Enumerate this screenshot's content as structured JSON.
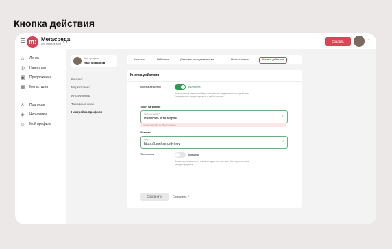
{
  "page_title": "Кнопка действия",
  "brand": {
    "name": "Мегасреда",
    "sub": "для людей в деле",
    "logo_letter": "m:"
  },
  "topbar": {
    "create_label": "Создать"
  },
  "sidebar": {
    "items": [
      {
        "label": "Лента",
        "icon": "home-icon",
        "glyph": "⌂"
      },
      {
        "label": "Навигатор",
        "icon": "compass-icon",
        "glyph": "◎"
      },
      {
        "label": "Предложения",
        "icon": "briefcase-icon",
        "glyph": "▣"
      },
      {
        "label": "Мегастудия",
        "icon": "grid-icon",
        "glyph": "▦"
      },
      {
        "label": "Подписки",
        "icon": "add-user-icon",
        "glyph": "♙"
      },
      {
        "label": "Черновики",
        "icon": "layers-icon",
        "glyph": "◈"
      },
      {
        "label": "Мой профиль",
        "icon": "smile-icon",
        "glyph": "☺"
      }
    ]
  },
  "profile": {
    "sub": "Ваш профиль",
    "name": "Иван Морданов"
  },
  "side_menu": [
    "Контент",
    "Маркетплейс",
    "Инструменты",
    "Тарифный план",
    "Настройка профиля"
  ],
  "tabs": [
    "Контакты",
    "Рейтинги",
    "Дипломы и свидетельства",
    "Наши клиенты",
    "Кнопка действия"
  ],
  "form": {
    "section_title": "Кнопка действия",
    "action_label": "Кнопка действия",
    "action_state": "Включена",
    "action_hint_1": "Кнопка вверху вашего сообщества помогает людям выполнить действие.",
    "action_hint_2": "Кнопку можно отредактировать в любой момент",
    "text_label": "Текст на кнопке",
    "text_placeholder": "Текст на кнопке*",
    "text_value": "Написать в телеграм",
    "text_warn": "Кнопка имеет 19 из 25 допустимых",
    "link_label": "Ссылка",
    "link_placeholder": "Ввод*",
    "link_value": "https://t.me/ismordvinov",
    "type_label": "Тип ссылки",
    "type_state": "Внешняя",
    "type_hint_1": "Внешние открываются в новой вкладке, внутренние - без открытия новой",
    "type_hint_2": "вкладки браузера",
    "save_label": "Сохранить",
    "saved_label": "Сохранено ✓"
  }
}
